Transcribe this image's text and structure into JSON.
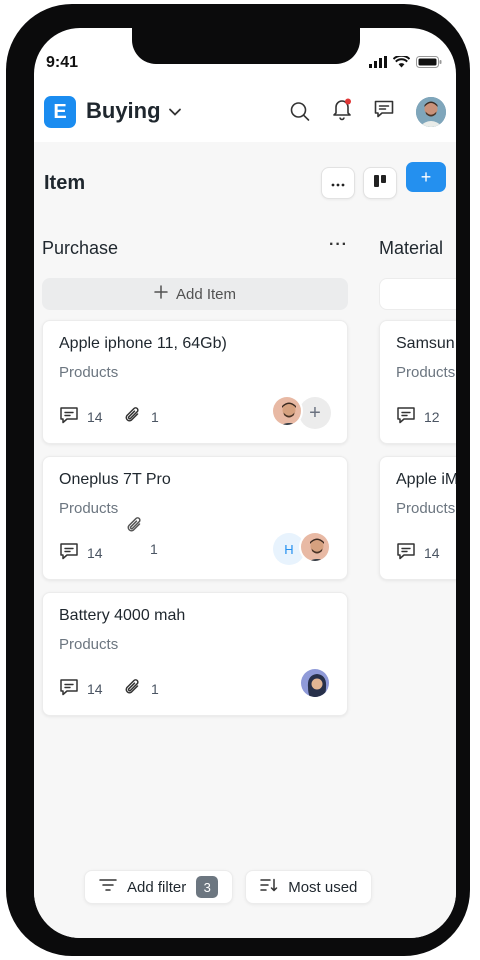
{
  "status_bar": {
    "time": "9:41"
  },
  "header": {
    "logo_letter": "E",
    "app_name": "Buying"
  },
  "page": {
    "title": "Item",
    "add_button": "+"
  },
  "columns": [
    {
      "title": "Purchase",
      "more": "···",
      "add_item_label": "Add Item",
      "cards": [
        {
          "title": "Apple iphone 11, 64Gb)",
          "subtitle": "Products",
          "comments": "14",
          "attachments": "1"
        },
        {
          "title": "Oneplus 7T Pro",
          "subtitle": "Products",
          "comments": "14",
          "attachments": "1",
          "assignee_initial": "H"
        },
        {
          "title": "Battery 4000 mah",
          "subtitle": "Products",
          "comments": "14",
          "attachments": "1"
        }
      ]
    },
    {
      "title": "Material",
      "cards": [
        {
          "title": "Samsun",
          "subtitle": "Products",
          "comments": "12"
        },
        {
          "title": "Apple iM",
          "subtitle": "Products",
          "comments": "14"
        }
      ]
    }
  ],
  "bottom_bar": {
    "filter_label": "Add filter",
    "filter_count": "3",
    "sort_label": "Most used"
  },
  "colors": {
    "accent": "#2490ef",
    "logo": "#1a8cf0",
    "notification_dot": "#e03636"
  }
}
